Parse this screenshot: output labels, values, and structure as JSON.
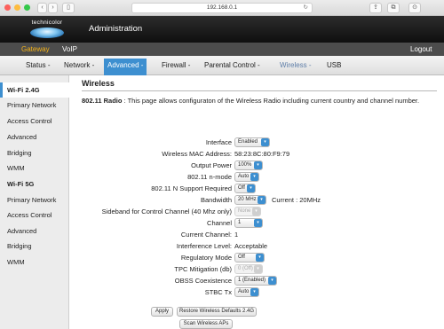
{
  "browser": {
    "url": "192.168.0.1",
    "back_icon": "chevron-left-icon",
    "forward_icon": "chevron-right-icon",
    "sidebar_icon": "sidebar-icon",
    "reload_icon": "reload-icon",
    "share_icon": "share-icon",
    "tabs_icon": "tabs-icon",
    "download_icon": "download-icon"
  },
  "header": {
    "logo_text": "technicolor",
    "title": "Administration"
  },
  "topnav": {
    "gateway": "Gateway",
    "voip": "VoIP",
    "logout": "Logout"
  },
  "subnav": {
    "status": "Status -",
    "network": "Network -",
    "advanced": "Advanced -",
    "firewall": "Firewall -",
    "parental": "Parental Control -",
    "wireless": "Wireless -",
    "usb": "USB"
  },
  "sidebar": {
    "items": [
      "Wi-Fi 2.4G",
      "Primary Network",
      "Access Control",
      "Advanced",
      "Bridging",
      "WMM",
      "Wi-Fi 5G",
      "Primary Network",
      "Access Control",
      "Advanced",
      "Bridging",
      "WMM"
    ]
  },
  "main": {
    "title": "Wireless",
    "desc_bold": "802.11 Radio",
    "desc_text": " :  This page allows configuraton of the Wireless Radio including current country and channel number.",
    "fields": {
      "interface_label": "Interface",
      "interface_value": "Enabled",
      "mac_label": "Wireless MAC Address:",
      "mac_value": "58:23:8C:80:F9:79",
      "output_power_label": "Output Power",
      "output_power_value": "100%",
      "nmode_label": "802.11 n-mode",
      "nmode_value": "Auto",
      "nsupport_label": "802.11 N Support Required",
      "nsupport_value": "Off",
      "bandwidth_label": "Bandwidth",
      "bandwidth_value": "20 MHz",
      "bandwidth_current": "Current :  20MHz",
      "sideband_label": "Sideband for Control Channel (40 Mhz only)",
      "sideband_value": "None",
      "channel_label": "Channel",
      "channel_value": "1",
      "current_channel_label": "Current Channel:",
      "current_channel_value": "1",
      "interference_label": "Interference Level:",
      "interference_value": "Acceptable",
      "regulatory_label": "Regulatory Mode",
      "regulatory_value": "Off",
      "tpc_label": "TPC Mitigation (db)",
      "tpc_value": "0 (Off)",
      "obss_label": "OBSS Coexistence",
      "obss_value": "1 (Enabled)",
      "stbc_label": "STBC Tx",
      "stbc_value": "Auto"
    },
    "buttons": {
      "apply": "Apply",
      "restore": "Restore Wireless Defaults 2.4G",
      "scan": "Scan Wireless APs"
    }
  },
  "colors": {
    "accent": "#3d8fd0",
    "gateway": "#f2b21a",
    "header_bg": "#1a1a1a",
    "nav_bg": "#4c4c4c"
  }
}
